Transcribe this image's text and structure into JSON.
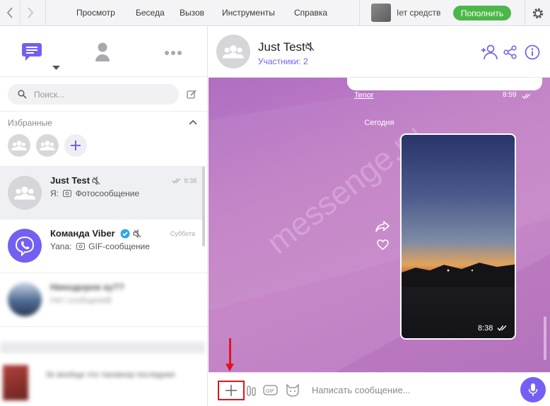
{
  "menu": [
    "Просмотр",
    "Беседа",
    "Вызов",
    "Инструменты",
    "Справка"
  ],
  "balance_text": "Iет средств",
  "topup_label": "Пополнить",
  "search": {
    "placeholder": "Поиск..."
  },
  "favorites": {
    "title": "Избранные"
  },
  "chats": [
    {
      "name": "Just Test",
      "preview_prefix": "Я:",
      "preview": "Фотосообщение",
      "time": "8:38"
    },
    {
      "name": "Команда Viber",
      "preview_prefix": "Yana:",
      "preview": "GIF-сообщение",
      "time": "Суббота"
    },
    {
      "name": "Нинодорок ку??",
      "preview": "Нет сообщений"
    },
    {
      "name": "Эх вообще что таоовоор последнее",
      "preview": ""
    }
  ],
  "header": {
    "title": "Just Test",
    "subtitle": "Участники: 2"
  },
  "messages": {
    "tenor_label": "Tenor",
    "top_time": "8:59",
    "day_label": "Сегодня",
    "photo_time": "8:38"
  },
  "watermark": "messenge.ru",
  "composer": {
    "placeholder": "Написать сообщение..."
  },
  "colors": {
    "accent": "#7360f2",
    "topup": "#4cb748",
    "annotation": "#e0141e"
  }
}
